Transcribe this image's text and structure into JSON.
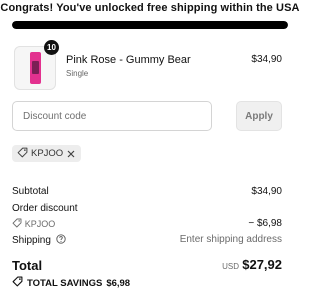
{
  "banner": {
    "message": "Congrats! You've unlocked free shipping within the USA",
    "progress_fraction": 1.0
  },
  "product": {
    "name": "Pink Rose - Gummy Bear",
    "variant": "Single",
    "price": "$34,90",
    "quantity": "10",
    "thumbnail_color": "#e3318f"
  },
  "discount": {
    "placeholder": "Discount code",
    "apply_label": "Apply",
    "applied_code": "KPJOO"
  },
  "summary": {
    "subtotal_label": "Subtotal",
    "subtotal_value": "$34,90",
    "order_discount_label": "Order discount",
    "discount_code": "KPJOO",
    "discount_value": "− $6,98",
    "shipping_label": "Shipping",
    "shipping_value": "Enter shipping address"
  },
  "total": {
    "label": "Total",
    "currency": "USD",
    "amount": "$27,92",
    "savings_label": "TOTAL SAVINGS",
    "savings_value": "$6,98"
  }
}
